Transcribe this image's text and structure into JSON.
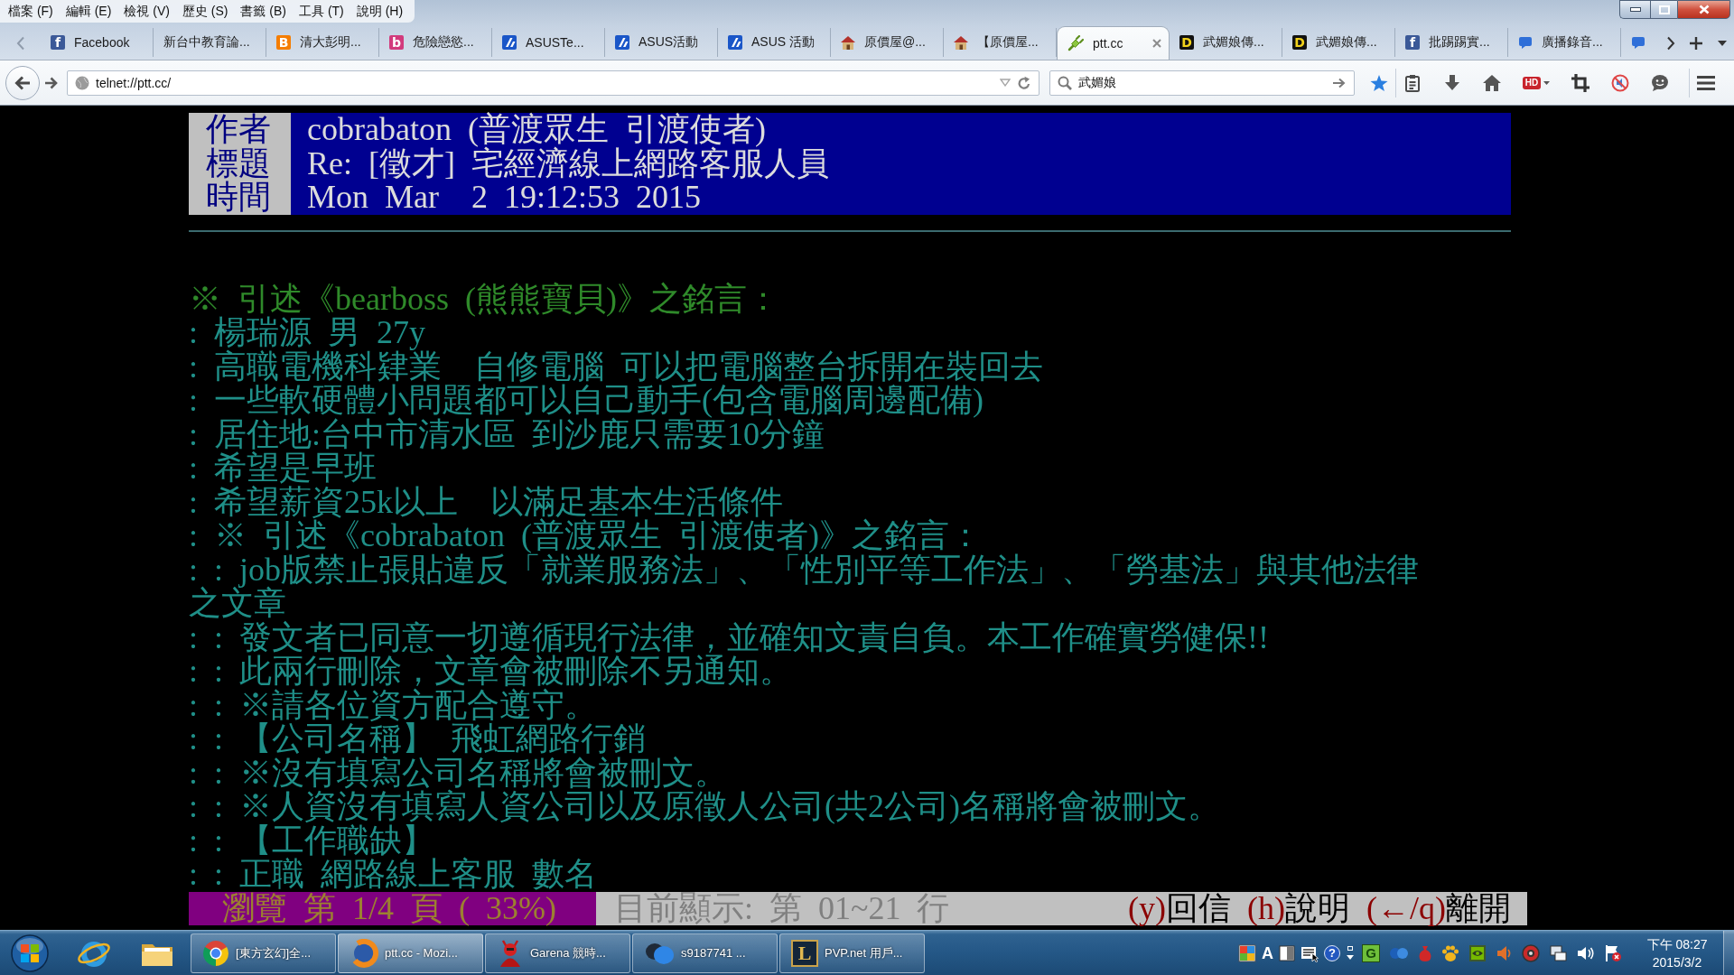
{
  "menu_bar": [
    "檔案 (F)",
    "編輯 (E)",
    "檢視 (V)",
    "歷史 (S)",
    "書籤 (B)",
    "工具 (T)",
    "說明 (H)"
  ],
  "tabs": [
    {
      "label": "Facebook",
      "selected": false,
      "favicon": {
        "kind": "letter",
        "glyph": "f",
        "color": "#3b5998"
      }
    },
    {
      "label": "新台中教育論...",
      "selected": false
    },
    {
      "label": "清大彭明...",
      "selected": false,
      "favicon": {
        "kind": "letter",
        "glyph": "B",
        "color": "#f57d00"
      }
    },
    {
      "label": "危險戀慾...",
      "selected": false,
      "favicon": {
        "kind": "letter",
        "glyph": "b",
        "color": "#d23a7c"
      }
    },
    {
      "label": "ASUSTe...",
      "selected": false,
      "favicon": {
        "kind": "stripes",
        "color": "#1a56c8"
      }
    },
    {
      "label": "ASUS活動",
      "selected": false,
      "favicon": {
        "kind": "stripes",
        "color": "#1a56c8"
      }
    },
    {
      "label": "ASUS 活動",
      "selected": false,
      "favicon": {
        "kind": "stripes",
        "color": "#1a56c8"
      }
    },
    {
      "label": "原價屋@...",
      "selected": false,
      "favicon": {
        "kind": "house"
      }
    },
    {
      "label": "【原價屋...",
      "selected": false,
      "favicon": {
        "kind": "house"
      }
    },
    {
      "label": "ptt.cc",
      "selected": true,
      "favicon": {
        "kind": "plug"
      }
    },
    {
      "label": "武媚娘傳...",
      "selected": false,
      "favicon": {
        "kind": "dark_letter",
        "glyph": "D"
      }
    },
    {
      "label": "武媚娘傳...",
      "selected": false,
      "favicon": {
        "kind": "dark_letter",
        "glyph": "D"
      }
    },
    {
      "label": "批踢踢實...",
      "selected": false,
      "favicon": {
        "kind": "letter",
        "glyph": "f",
        "color": "#3b5998"
      }
    },
    {
      "label": "廣播錄音...",
      "selected": false,
      "favicon": {
        "kind": "bubble"
      }
    },
    {
      "selected": false,
      "favicon": {
        "kind": "bubble"
      }
    }
  ],
  "address_bar": {
    "value": "telnet://ptt.cc/"
  },
  "search": {
    "value": "武媚娘"
  },
  "toolbar": {
    "hd_badge": "HD"
  },
  "article": {
    "header": [
      {
        "label": "作者",
        "value": "cobrabaton (普渡眾生 引渡使者)"
      },
      {
        "label": "標題",
        "value": "Re: [徵才] 宅經濟線上網路客服人員"
      },
      {
        "label": "時間",
        "value": "Mon Mar  2 19:12:53 2015"
      }
    ],
    "lines": [
      {
        "text": "※ 引述《bearboss (熊熊寶貝)》之銘言：",
        "color": "#2f8a2a"
      },
      {
        "text": ": 楊瑞源 男 27y",
        "color": "#1f8f88"
      },
      {
        "text": ": 高職電機科肄業  自修電腦 可以把電腦整台拆開在裝回去",
        "color": "#1f8f88"
      },
      {
        "text": ": 一些軟硬體小問題都可以自己動手(包含電腦周邊配備)",
        "color": "#1f8f88"
      },
      {
        "text": ": 居住地:台中市清水區 到沙鹿只需要10分鐘",
        "color": "#1f8f88"
      },
      {
        "text": ": 希望是早班",
        "color": "#1f8f88"
      },
      {
        "text": ": 希望薪資25k以上  以滿足基本生活條件",
        "color": "#1f8f88"
      },
      {
        "text": ": ※ 引述《cobrabaton (普渡眾生 引渡使者)》之銘言：",
        "color": "#1f8f88"
      },
      {
        "text": ": : job版禁止張貼違反「就業服務法」、「性別平等工作法」、「勞基法」與其他法律",
        "color": "#1f8f88"
      },
      {
        "text": "之文章",
        "color": "#1f8f88"
      },
      {
        "text": ": : 發文者已同意一切遵循現行法律，並確知文責自負。本工作確實勞健保!!",
        "color": "#1f8f88"
      },
      {
        "text": ": : 此兩行刪除，文章會被刪除不另通知。",
        "color": "#1f8f88"
      },
      {
        "text": ": : ※請各位資方配合遵守。",
        "color": "#1f8f88"
      },
      {
        "text": ": : 【公司名稱】 飛虹網路行銷",
        "color": "#1f8f88"
      },
      {
        "text": ": : ※沒有填寫公司名稱將會被刪文。",
        "color": "#1f8f88"
      },
      {
        "text": ": : ※人資沒有填寫人資公司以及原徵人公司(共2公司)名稱將會被刪文。",
        "color": "#1f8f88"
      },
      {
        "text": ": : 【工作職缺】",
        "color": "#1f8f88"
      },
      {
        "text": ": : 正職 網路線上客服 數名",
        "color": "#1f8f88"
      }
    ],
    "status_bar": {
      "page": "瀏覽 第 1/4 頁 ( 33%)",
      "position": "目前顯示: 第 01~21 行",
      "commands": [
        {
          "key": "(y)",
          "label": "回信"
        },
        {
          "key": "(h)",
          "label": "說明"
        },
        {
          "key": "(←/q)",
          "label": "離開"
        }
      ]
    }
  },
  "taskbar": {
    "windows": [
      {
        "label": "[東方玄幻]全...",
        "kind": "segmented",
        "selected": false
      },
      {
        "label": "ptt.cc - Mozi...",
        "kind": "swirl",
        "selected": true
      },
      {
        "label": "Garena 競時...",
        "kind": "mascot",
        "selected": false
      },
      {
        "label": "s9187741 ...",
        "kind": "bubbles",
        "selected": false
      },
      {
        "label": "PVP.net 用戶...",
        "kind": "letter",
        "glyph": "L",
        "selected": false
      }
    ],
    "language_bar": [
      {
        "kind": "palette"
      },
      {
        "kind": "glyph",
        "text": "A"
      },
      {
        "kind": "half_square"
      },
      {
        "kind": "keyboard"
      },
      {
        "kind": "help",
        "text": "?"
      },
      {
        "kind": "updown"
      }
    ],
    "tray": [
      {
        "kind": "glyph_tile",
        "text": "G"
      },
      {
        "kind": "dots"
      },
      {
        "kind": "pouch"
      },
      {
        "kind": "paw"
      },
      {
        "kind": "chip"
      },
      {
        "kind": "speaker"
      },
      {
        "kind": "ring"
      },
      {
        "kind": "network"
      },
      {
        "kind": "volume"
      },
      {
        "kind": "flag"
      }
    ],
    "clock": {
      "time": "下午 08:27",
      "date": "2015/3/2"
    }
  }
}
